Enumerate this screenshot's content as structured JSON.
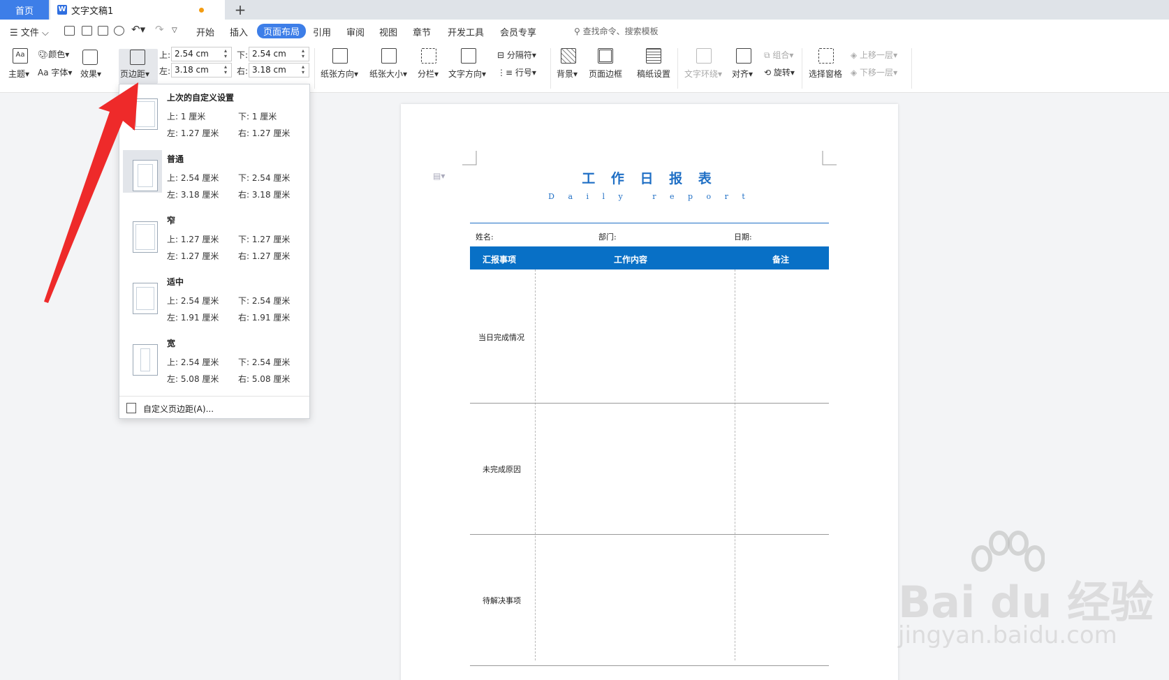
{
  "tabs": {
    "home": "首页",
    "doc": "文字文稿1"
  },
  "menu": {
    "file": "文件",
    "items": [
      "开始",
      "插入",
      "页面布局",
      "引用",
      "审阅",
      "视图",
      "章节",
      "开发工具",
      "会员专享"
    ],
    "active": "页面布局",
    "search": "查找命令、搜索模板"
  },
  "ribbon": {
    "theme": "主题",
    "color": "颜色",
    "font": "Aa 字体",
    "effect": "效果",
    "margins": "页边距",
    "top_label": "上:",
    "top_value": "2.54 cm",
    "bottom_label": "下:",
    "bottom_value": "2.54 cm",
    "left_label": "左:",
    "left_value": "3.18 cm",
    "right_label": "右:",
    "right_value": "3.18 cm",
    "orientation": "纸张方向",
    "size": "纸张大小",
    "columns": "分栏",
    "text_direction": "文字方向",
    "breaks": "分隔符",
    "line_numbers": "行号",
    "background": "背景",
    "page_border": "页面边框",
    "manuscript": "稿纸设置",
    "wrap": "文字环绕",
    "align": "对齐",
    "group": "组合",
    "rotate": "旋转",
    "selection_pane": "选择窗格",
    "bring_forward": "上移一层",
    "send_backward": "下移一层"
  },
  "dropdown": {
    "options": [
      {
        "title": "上次的自定义设置",
        "top": "上: 1 厘米",
        "bottom": "下: 1 厘米",
        "left": "左: 1.27 厘米",
        "right": "右: 1.27 厘米"
      },
      {
        "title": "普通",
        "top": "上: 2.54 厘米",
        "bottom": "下: 2.54 厘米",
        "left": "左: 3.18 厘米",
        "right": "右: 3.18 厘米"
      },
      {
        "title": "窄",
        "top": "上: 1.27 厘米",
        "bottom": "下: 1.27 厘米",
        "left": "左: 1.27 厘米",
        "right": "右: 1.27 厘米"
      },
      {
        "title": "适中",
        "top": "上: 2.54 厘米",
        "bottom": "下: 2.54 厘米",
        "left": "左: 1.91 厘米",
        "right": "右: 1.91 厘米"
      },
      {
        "title": "宽",
        "top": "上: 2.54 厘米",
        "bottom": "下: 2.54 厘米",
        "left": "左: 5.08 厘米",
        "right": "右: 5.08 厘米"
      }
    ],
    "custom": "自定义页边距(A)..."
  },
  "document": {
    "title": "工 作 日 报 表",
    "subtitle": "D a i l y   r e p o r t",
    "name_label": "姓名:",
    "dept_label": "部门:",
    "date_label": "日期:",
    "headers": [
      "汇报事项",
      "工作内容",
      "备注"
    ],
    "rows": [
      "当日完成情况",
      "未完成原因",
      "待解决事项"
    ]
  },
  "watermark": {
    "logo": "Bai du 经验",
    "url": "jingyan.baidu.com"
  },
  "colors": {
    "accent": "#3d7ee8",
    "table_header": "#0870c6",
    "title": "#1f6fc5",
    "arrow": "#ee2a2a"
  }
}
